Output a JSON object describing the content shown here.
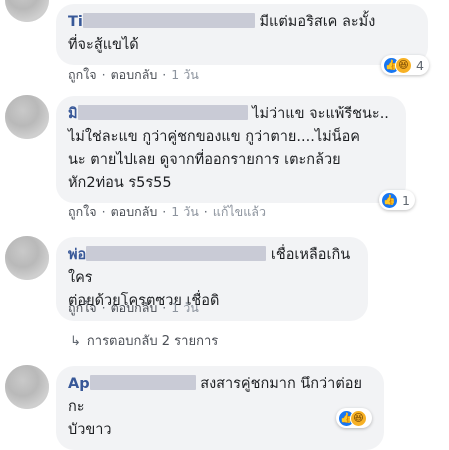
{
  "comments": [
    {
      "name": "Ti",
      "text_line1": "มีแต่มอริสเค ละมั้ง",
      "text_line2": "ที่จะสู้แขได้",
      "actions": {
        "like": "ถูกใจ",
        "reply": "ตอบกลับ",
        "time": "1 วัน"
      },
      "reactions": {
        "count": "4",
        "icons": [
          "like-icon",
          "haha-icon"
        ]
      }
    },
    {
      "name": "มิ",
      "text_line1": "ไม่ว่าแข จะแพ้รีชนะ..",
      "text_line2": "ไม่ใช่ละแข กูว่าคู่ชกของแข กูว่าตาย....ไม่น็อค",
      "text_line3": "นะ ตายไปเลย ดูจากที่ออกรายการ เตะกล้วย",
      "text_line4": "หัก2ท่อน ร5ร55",
      "actions": {
        "like": "ถูกใจ",
        "reply": "ตอบกลับ",
        "time": "1 วัน",
        "edited": "แก้ไขแล้ว"
      },
      "reactions": {
        "count": "1",
        "icons": [
          "like-icon"
        ]
      }
    },
    {
      "name": "พ่อ",
      "text_line1": "เชื่อเหลือเกิน ใคร",
      "text_line2": "ต่อยด้วยโครตซวย เชื่อดิ",
      "actions": {
        "like": "ถูกใจ",
        "reply": "ตอบกลับ",
        "time": "1 วัน"
      }
    },
    {
      "name": "Ap",
      "text_line1": "สงสารคู่ชกมาก นึกว่าต่อยกะ",
      "text_line2": "บัวขาว"
    }
  ],
  "replies_link": "การตอบกลับ 2 รายการ",
  "colors": {
    "name": "#385898",
    "bubble": "#f2f3f5",
    "like": "#1877f2",
    "haha": "#f7b125"
  }
}
